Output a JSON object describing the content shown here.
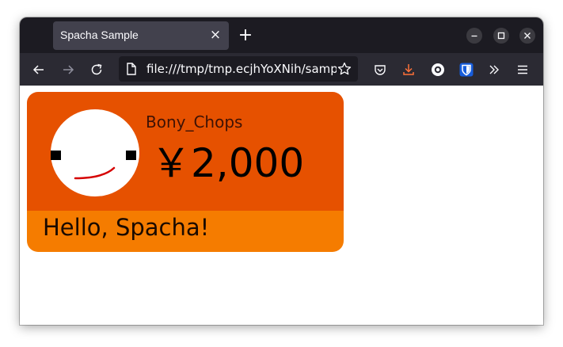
{
  "browser": {
    "tab_title": "Spacha Sample",
    "new_tab_glyph": "+",
    "close_glyph": "×",
    "url": "file:///tmp/tmp.ecjhYoXNih/sampl",
    "colors": {
      "tabbar": "#1c1b22",
      "active_tab": "#42414d",
      "toolbar": "#2b2a33",
      "text": "#fbfbfe",
      "download_accent": "#ff7139",
      "bitwarden": "#175ddc"
    },
    "icons": [
      "back-arrow-icon",
      "forward-arrow-icon",
      "reload-icon",
      "page-icon",
      "bookmark-star-icon",
      "pocket-icon",
      "download-icon",
      "extension-icon",
      "bitwarden-icon",
      "more-tools-icon",
      "menu-icon",
      "minimize-icon",
      "maximize-icon",
      "close-window-icon"
    ]
  },
  "card": {
    "username": "Bony_Chops",
    "amount": "￥2,000",
    "message": "Hello, Spacha!",
    "colors": {
      "top": "#e65100",
      "bottom": "#f57c00",
      "name_text": "#3e1205",
      "amount_text": "#000000",
      "message_text": "#1a0a00",
      "avatar_bg": "#ffffff",
      "avatar_eye": "#000000",
      "avatar_mouth": "#d50000"
    }
  }
}
